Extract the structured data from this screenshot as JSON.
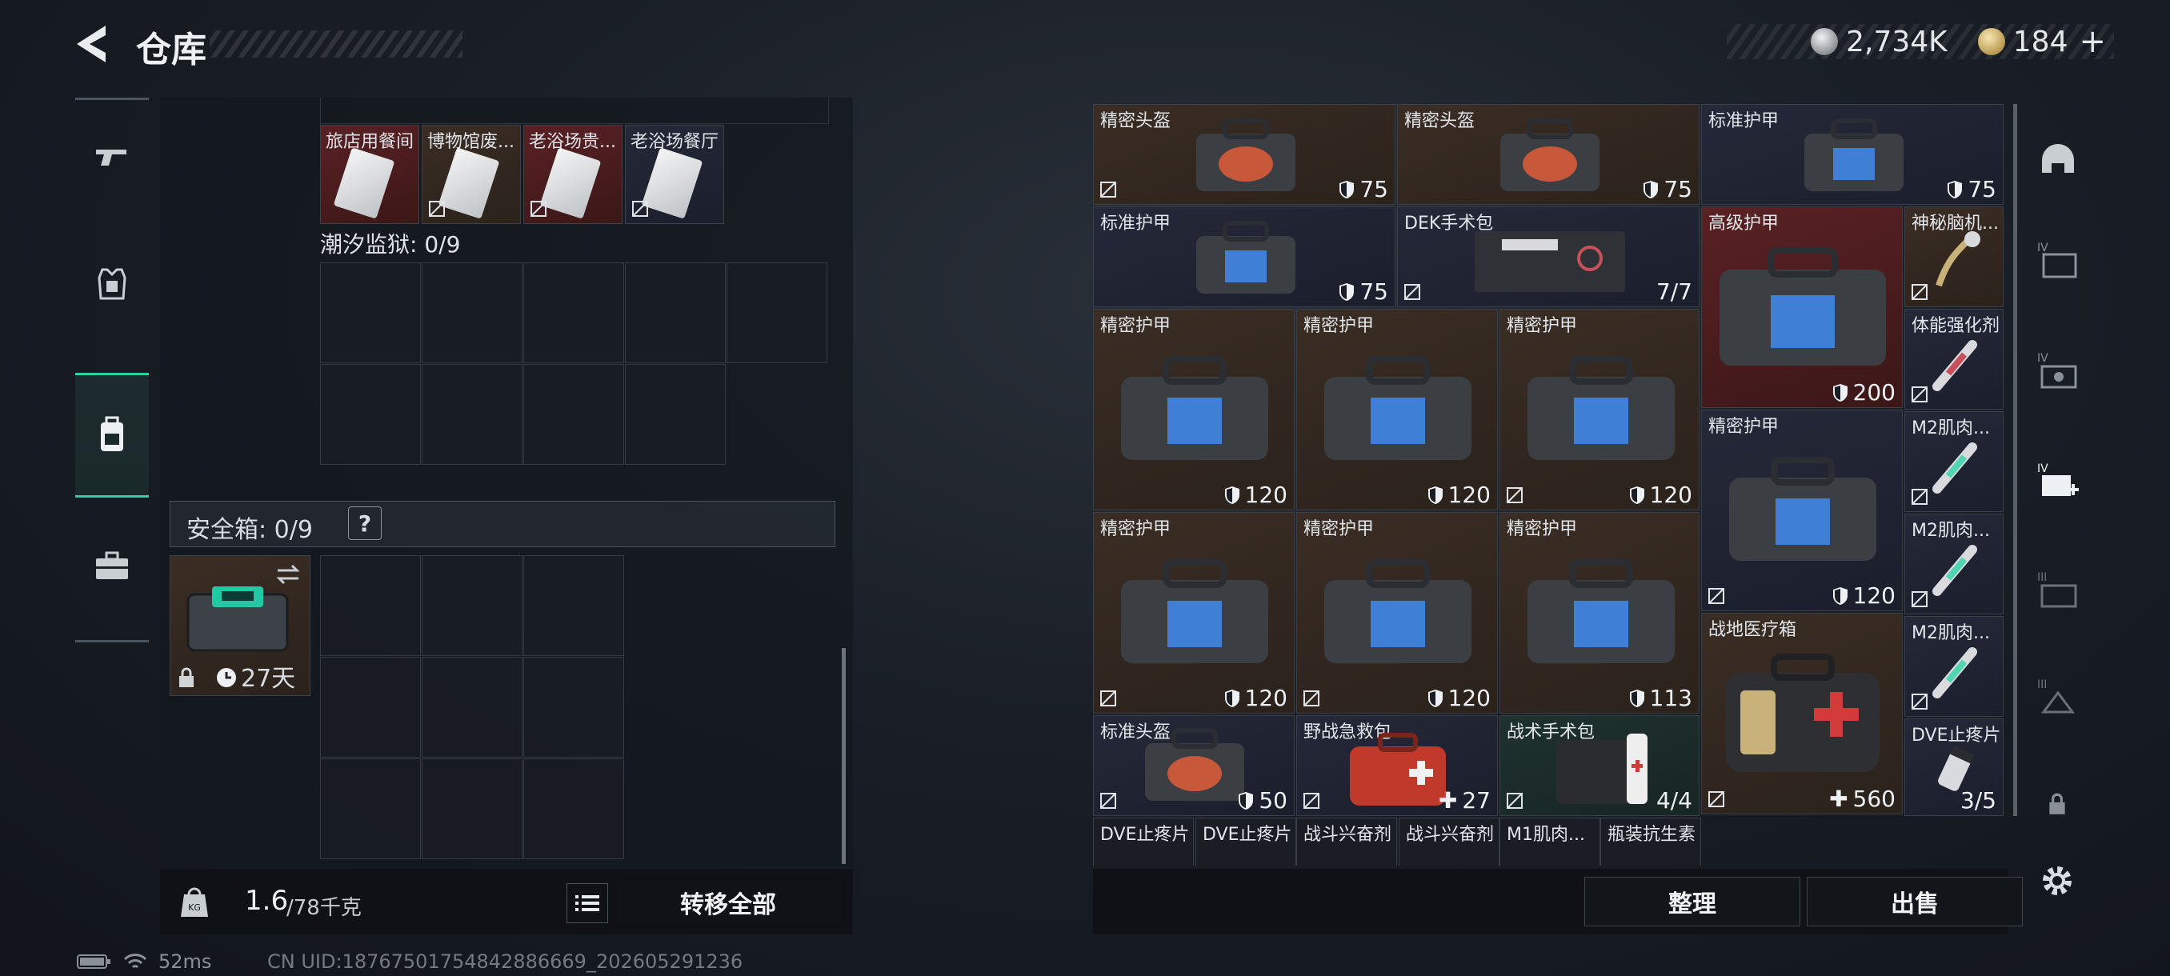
{
  "header": {
    "title": "仓库",
    "silver_amount": "2,734K",
    "gold_amount": "184",
    "add_label": "+"
  },
  "left_tabs": [
    {
      "icon": "gun-icon"
    },
    {
      "icon": "armor-icon"
    },
    {
      "icon": "backpack-icon",
      "active": true
    },
    {
      "icon": "briefcase-icon"
    }
  ],
  "container_items": [
    {
      "name": "旅店用餐间"
    },
    {
      "name": "博物馆废..."
    },
    {
      "name": "老浴场贵..."
    },
    {
      "name": "老浴场餐厅"
    }
  ],
  "prison_section": {
    "label": "潮汐监狱: 0/9"
  },
  "safe_box": {
    "label": "安全箱: 0/9",
    "help": "?",
    "duration": "27天"
  },
  "left_bottom": {
    "weight_current": "1.6",
    "weight_max": "/78千克",
    "transfer_all": "转移全部"
  },
  "stash_items": [
    {
      "name": "精密头盔",
      "value": "75",
      "kind": "shield"
    },
    {
      "name": "精密头盔",
      "value": "75",
      "kind": "shield"
    },
    {
      "name": "标准护甲",
      "value": "75",
      "kind": "shield"
    },
    {
      "name": "标准护甲",
      "value": "75",
      "kind": "shield"
    },
    {
      "name": "DEK手术包",
      "value": "7/7",
      "kind": "count"
    },
    {
      "name": "高级护甲",
      "value": "200",
      "kind": "shield"
    },
    {
      "name": "神秘脑机...",
      "value": "",
      "kind": "none"
    },
    {
      "name": "精密护甲",
      "value": "120",
      "kind": "shield"
    },
    {
      "name": "精密护甲",
      "value": "120",
      "kind": "shield"
    },
    {
      "name": "精密护甲",
      "value": "120",
      "kind": "shield"
    },
    {
      "name": "体能强化剂",
      "value": "",
      "kind": "none"
    },
    {
      "name": "精密护甲",
      "value": "120",
      "kind": "shield"
    },
    {
      "name": "M2肌肉...",
      "value": "",
      "kind": "none"
    },
    {
      "name": "精密护甲",
      "value": "120",
      "kind": "shield"
    },
    {
      "name": "精密护甲",
      "value": "120",
      "kind": "shield"
    },
    {
      "name": "精密护甲",
      "value": "113",
      "kind": "shield"
    },
    {
      "name": "M2肌肉...",
      "value": "",
      "kind": "none"
    },
    {
      "name": "战地医疗箱",
      "value": "560",
      "kind": "heal"
    },
    {
      "name": "M2肌肉...",
      "value": "",
      "kind": "none"
    },
    {
      "name": "标准头盔",
      "value": "50",
      "kind": "shield"
    },
    {
      "name": "野战急救包",
      "value": "27",
      "kind": "heal"
    },
    {
      "name": "战术手术包",
      "value": "4/4",
      "kind": "count"
    },
    {
      "name": "DVE止疼片",
      "value": "3/5",
      "kind": "count"
    },
    {
      "name": "DVE止疼片"
    },
    {
      "name": "DVE止疼片"
    },
    {
      "name": "战斗兴奋剂"
    },
    {
      "name": "战斗兴奋剂"
    },
    {
      "name": "M1肌肉..."
    },
    {
      "name": "瓶装抗生素"
    }
  ],
  "right_bottom": {
    "sort_label": "整理",
    "sell_label": "出售"
  },
  "right_tabs": [
    {
      "icon": "helmet-icon"
    },
    {
      "icon": "tier-iv-folder-icon",
      "tier": "IV"
    },
    {
      "icon": "tier-iv-case-icon",
      "tier": "IV"
    },
    {
      "icon": "tier-iv-medkit-icon",
      "tier": "IV"
    },
    {
      "icon": "tier-iii-case-icon",
      "tier": "III"
    },
    {
      "icon": "tier-iii-box-icon",
      "tier": "III"
    }
  ],
  "status_bar": {
    "ping": "52ms",
    "uid": "CN UID:18767501754842886669_202605291236"
  },
  "colors": {
    "accent": "#2fd0a8",
    "brown_cell": "#3a2d24",
    "navy_cell": "#242838",
    "red_cell": "#5a2124",
    "teal_cell": "#1f3230"
  }
}
